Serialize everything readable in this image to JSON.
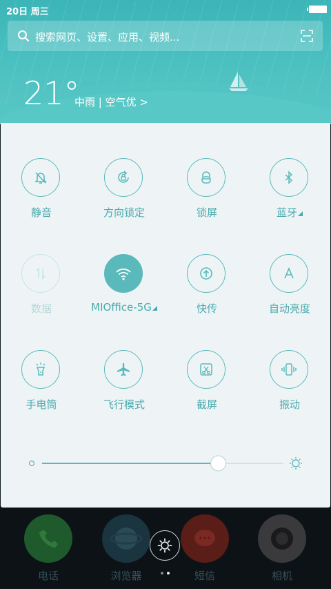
{
  "status": {
    "time": "20日 周三"
  },
  "search": {
    "placeholder": "搜索网页、设置、应用、视频..."
  },
  "weather": {
    "temp": "21°",
    "desc": "中雨 | 空气优 >"
  },
  "toggles": [
    {
      "label": "静音",
      "icon": "mute-bell-icon",
      "state": "off"
    },
    {
      "label": "方向锁定",
      "icon": "rotation-lock-icon",
      "state": "off"
    },
    {
      "label": "锁屏",
      "icon": "lock-icon",
      "state": "off"
    },
    {
      "label": "蓝牙",
      "icon": "bluetooth-icon",
      "state": "off",
      "has_menu": true
    },
    {
      "label": "数据",
      "icon": "mobile-data-icon",
      "state": "disabled"
    },
    {
      "label": "MIOffice-5G",
      "icon": "wifi-icon",
      "state": "on",
      "has_menu": true
    },
    {
      "label": "快传",
      "icon": "quick-transfer-icon",
      "state": "off"
    },
    {
      "label": "自动亮度",
      "icon": "auto-brightness-icon",
      "state": "off"
    },
    {
      "label": "手电筒",
      "icon": "flashlight-icon",
      "state": "off"
    },
    {
      "label": "飞行模式",
      "icon": "airplane-icon",
      "state": "off"
    },
    {
      "label": "截屏",
      "icon": "screenshot-icon",
      "state": "off"
    },
    {
      "label": "振动",
      "icon": "vibrate-icon",
      "state": "off"
    }
  ],
  "brightness": {
    "level": 0.73
  },
  "dock": {
    "apps": [
      {
        "label": "电话",
        "icon": "phone-icon"
      },
      {
        "label": "浏览器",
        "icon": "browser-icon"
      },
      {
        "label": "短信",
        "icon": "message-icon"
      },
      {
        "label": "相机",
        "icon": "camera-icon"
      }
    ]
  },
  "colors": {
    "accent": "#5ab9bb",
    "header": "#4bbfc0",
    "panel": "#eef4f6"
  }
}
